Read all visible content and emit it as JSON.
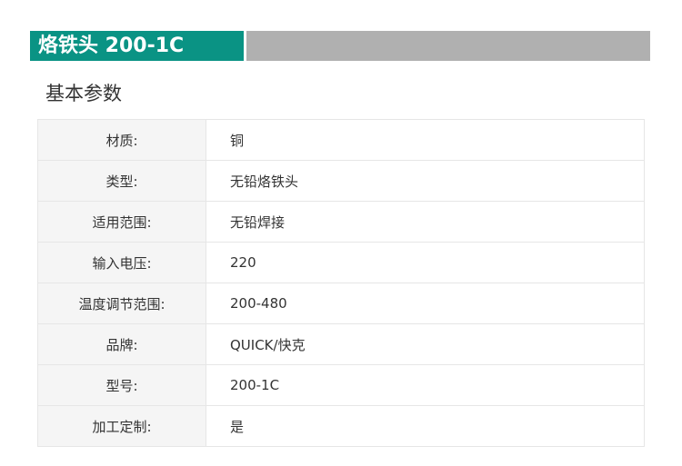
{
  "header": {
    "title": "烙铁头 200-1C",
    "colors": {
      "title_bg": "#0a9384",
      "bar_gray": "#b0b0b0"
    }
  },
  "section": {
    "heading": "基本参数"
  },
  "specs": [
    {
      "label": "材质:",
      "value": "铜"
    },
    {
      "label": "类型:",
      "value": "无铅烙铁头"
    },
    {
      "label": "适用范围:",
      "value": "无铅焊接"
    },
    {
      "label": "输入电压:",
      "value": "220"
    },
    {
      "label": "温度调节范围:",
      "value": "200-480"
    },
    {
      "label": "品牌:",
      "value": "QUICK/快克"
    },
    {
      "label": "型号:",
      "value": "200-1C"
    },
    {
      "label": "加工定制:",
      "value": "是"
    }
  ]
}
